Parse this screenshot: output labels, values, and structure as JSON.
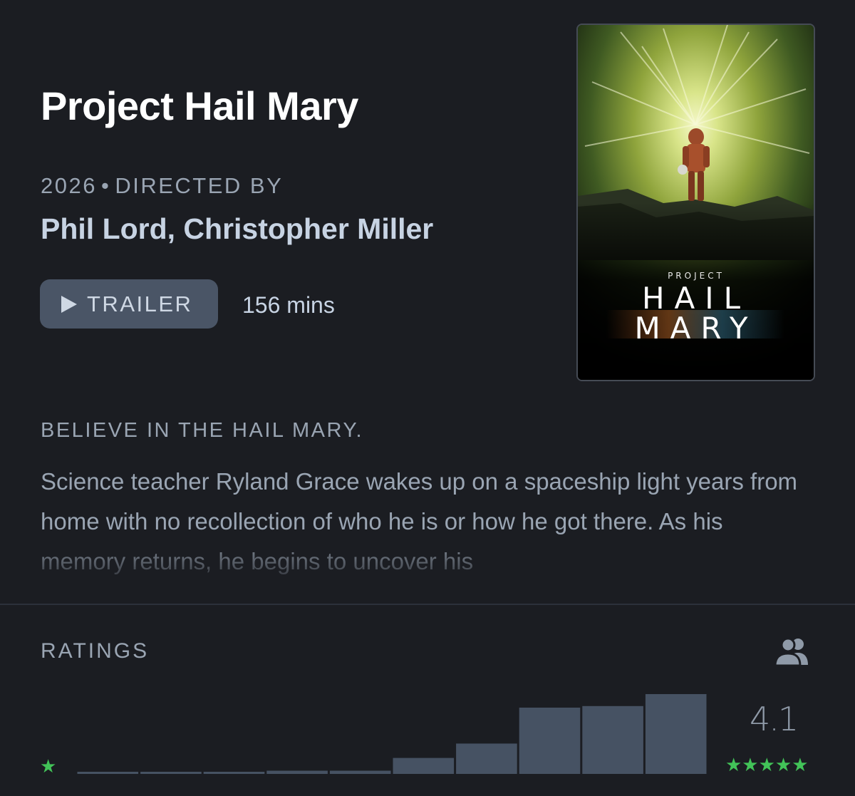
{
  "film": {
    "title": "Project Hail Mary",
    "year": "2026",
    "separator": "•",
    "directed_by_label": "DIRECTED BY",
    "directors": "Phil Lord, Christopher Miller",
    "trailer_label": "TRAILER",
    "runtime": "156 mins",
    "tagline": "BELIEVE IN THE HAIL MARY.",
    "synopsis": "Science teacher Ryland Grace wakes up on a spaceship light years from home with no recollection of who he is or how he got there. As his memory returns, he begins to uncover his"
  },
  "poster": {
    "line1": "PROJECT",
    "line2": "HAIL",
    "line3": "MARY"
  },
  "ratings": {
    "label": "RATINGS",
    "average": "4.1",
    "low_star": "★",
    "high_stars": "★★★★★",
    "star_color": "#42c358",
    "bar_color": "#465263",
    "distribution": [
      0.012,
      0.012,
      0.012,
      0.04,
      0.04,
      0.2,
      0.38,
      0.83,
      0.85,
      1.0
    ],
    "users_icon": "users-icon"
  }
}
